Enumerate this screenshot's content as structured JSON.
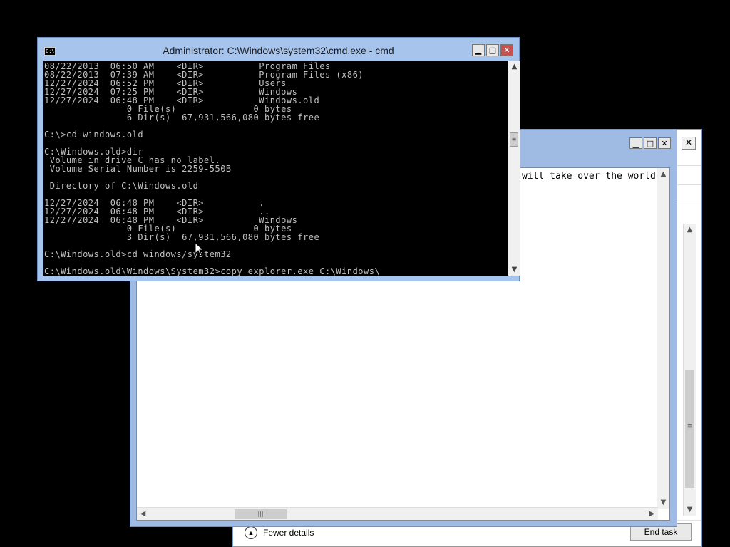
{
  "task_manager": {
    "close_label": "✕",
    "fewer_details_label": "Fewer details",
    "end_task_label": "End task"
  },
  "notepad": {
    "buttons": {
      "minimize": "▁",
      "maximize": "□",
      "close": "✕"
    },
    "visible_text": "will take over the world"
  },
  "cmd": {
    "title": "Administrator: C:\\Windows\\system32\\cmd.exe - cmd",
    "icon_text": "C:\\",
    "buttons": {
      "minimize": "▁",
      "maximize": "□",
      "close": "✕"
    },
    "console_text": "08/22/2013  06:50 AM    <DIR>          Program Files\n08/22/2013  07:39 AM    <DIR>          Program Files (x86)\n12/27/2024  06:52 PM    <DIR>          Users\n12/27/2024  07:25 PM    <DIR>          Windows\n12/27/2024  06:48 PM    <DIR>          Windows.old\n               0 File(s)              0 bytes\n               6 Dir(s)  67,931,566,080 bytes free\n\nC:\\>cd windows.old\n\nC:\\Windows.old>dir\n Volume in drive C has no label.\n Volume Serial Number is 2259-550B\n\n Directory of C:\\Windows.old\n\n12/27/2024  06:48 PM    <DIR>          .\n12/27/2024  06:48 PM    <DIR>          ..\n12/27/2024  06:48 PM    <DIR>          Windows\n               0 File(s)              0 bytes\n               3 Dir(s)  67,931,566,080 bytes free\n\nC:\\Windows.old>cd windows/system32\n\nC:\\Windows.old\\Windows\\System32>copy explorer.exe C:\\Windows\\"
  }
}
